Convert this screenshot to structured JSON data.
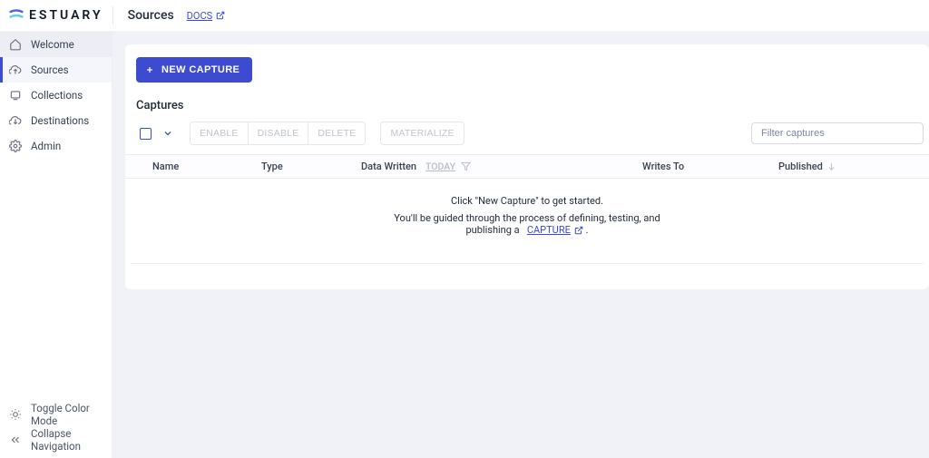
{
  "brand": {
    "name": "ESTUARY"
  },
  "topbar": {
    "title": "Sources",
    "docs_label": "DOCS"
  },
  "sidebar": {
    "items": [
      {
        "label": "Welcome",
        "icon": "home"
      },
      {
        "label": "Sources",
        "icon": "upload-cloud"
      },
      {
        "label": "Collections",
        "icon": "layers"
      },
      {
        "label": "Destinations",
        "icon": "download-cloud"
      },
      {
        "label": "Admin",
        "icon": "gear"
      }
    ],
    "footer": {
      "toggle_label": "Toggle Color Mode",
      "collapse_label": "Collapse Navigation"
    }
  },
  "main": {
    "new_capture_label": "NEW CAPTURE",
    "section_title": "Captures",
    "toolbar": {
      "enable": "ENABLE",
      "disable": "DISABLE",
      "delete": "DELETE",
      "materialize": "MATERIALIZE",
      "filter_placeholder": "Filter captures"
    },
    "columns": {
      "name": "Name",
      "type": "Type",
      "data_written": "Data Written",
      "range": "TODAY",
      "writes_to": "Writes To",
      "published": "Published"
    },
    "empty": {
      "line1": "Click \"New Capture\" to get started.",
      "line2_prefix": "You'll be guided through the process of defining, testing, and",
      "line2_suffix_a": "publishing a",
      "capture_link": "CAPTURE",
      "period": "."
    }
  }
}
